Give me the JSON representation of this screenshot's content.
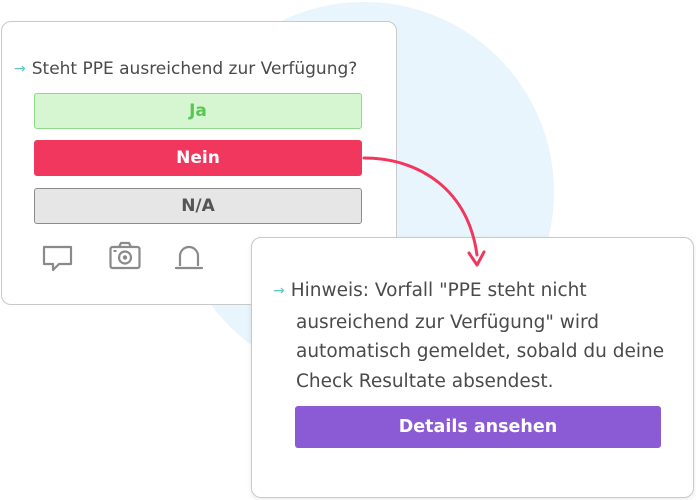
{
  "question_card": {
    "question": "Steht PPE ausreichend zur Verfügung?",
    "answers": {
      "yes": "Ja",
      "no": "Nein",
      "na": "N/A"
    },
    "icons": [
      "comment-icon",
      "camera-icon",
      "alarm-icon"
    ]
  },
  "hint_card": {
    "lines": [
      "Hinweis: Vorfall \"PPE steht nicht",
      "ausreichend zur Verfügung\" wird",
      "automatisch gemeldet, sobald du deine",
      "Check Resultate absendest."
    ],
    "button_label": "Details ansehen"
  },
  "colors": {
    "accent_teal": "#5fc6bf",
    "yes_green": "#5ac653",
    "no_red": "#f2375e",
    "details_purple": "#8a5bd5",
    "background_circle": "#e8f5fc"
  }
}
